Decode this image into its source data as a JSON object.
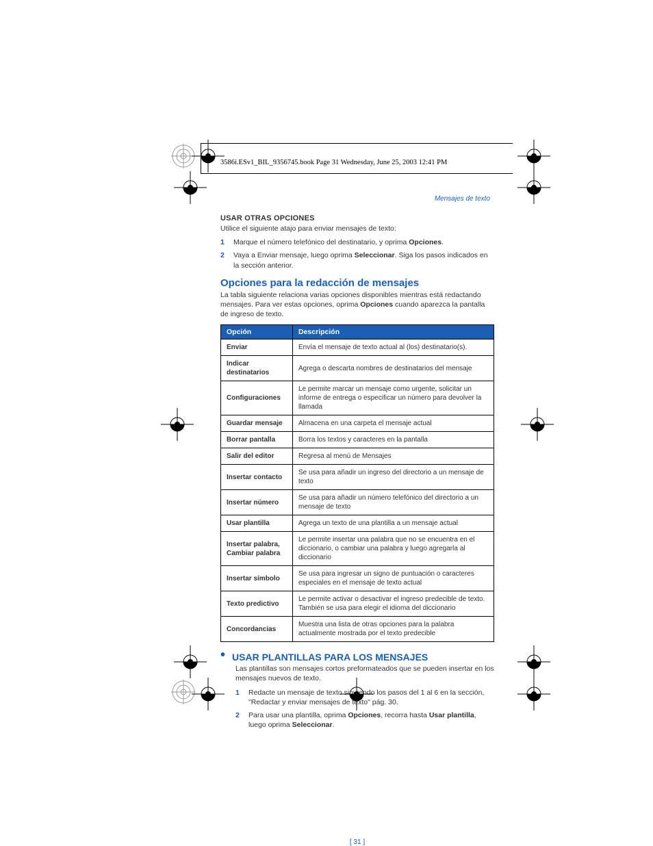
{
  "header": "3586i.ESv1_BIL_9356745.book  Page 31  Wednesday, June 25, 2003  12:41 PM",
  "breadcrumb": "Mensajes de texto",
  "s1_title": "USAR OTRAS OPCIONES",
  "s1_intro": "Utilice el siguiente atajo para enviar mensajes de texto:",
  "s1_li1_a": "Marque el número telefónico del destinatario, y oprima ",
  "s1_li1_b": "Opciones",
  "s1_li1_c": ".",
  "s1_li2_a": "Vaya a Enviar mensaje, luego oprima ",
  "s1_li2_b": "Seleccionar",
  "s1_li2_c": ". Siga los pasos indicados en la sección anterior.",
  "h2_a": "Opciones para la redacción de mensajes",
  "h2_a_p1": "La tabla siguiente relaciona varias opciones disponibles mientras está redactando mensajes. Para ver estas opciones, oprima ",
  "h2_a_p1_b": "Opciones",
  "h2_a_p1_c": " cuando aparezca la pantalla de ingreso de texto.",
  "th1": "Opción",
  "th2": "Descripción",
  "rows": [
    {
      "o": "Enviar",
      "d": "Envía el mensaje de texto actual al (los) destinatario(s)."
    },
    {
      "o": "Indicar destinatarios",
      "d": "Agrega o descarta nombres de destinatarios del mensaje"
    },
    {
      "o": "Configuraciones",
      "d": "Le permite marcar un mensaje como urgente, solicitar un informe de entrega o especificar un número para devolver la llamada"
    },
    {
      "o": "Guardar mensaje",
      "d": "Almacena en una carpeta el mensaje actual"
    },
    {
      "o": "Borrar pantalla",
      "d": "Borra los textos y caracteres en la pantalla"
    },
    {
      "o": "Salir del editor",
      "d": "Regresa al menú de Mensajes"
    },
    {
      "o": "Insertar contacto",
      "d": "Se usa para añadir un ingreso del directorio a un mensaje de texto"
    },
    {
      "o": "Insertar número",
      "d": "Se usa para añadir un número telefónico del directorio a un mensaje de texto"
    },
    {
      "o": "Usar plantilla",
      "d": "Agrega un texto de una plantilla a un mensaje actual"
    },
    {
      "o": "Insertar palabra, Cambiar palabra",
      "d": "Le permite insertar una palabra que no se encuentra en el diccionario, o cambiar una palabra y luego agregarla al diccionario"
    },
    {
      "o": "Insertar símbolo",
      "d": "Se usa para ingresar un signo de puntuación o caracteres especiales en el mensaje de texto actual"
    },
    {
      "o": "Texto predictivo",
      "d": "Le permite activar o desactivar el ingreso predecible de texto. También se usa para elegir el idioma del diccionario"
    },
    {
      "o": "Concordancias",
      "d": "Muestra una lista de otras opciones para la palabra actualmente mostrada por el texto predecible"
    }
  ],
  "h2_b": "USAR PLANTILLAS PARA LOS MENSAJES",
  "h2_b_p": "Las plantillas son mensajes cortos preformateados que se pueden insertar en los mensajes nuevos de texto.",
  "s3_li1": "Redacte un mensaje de texto siguiendo los pasos del 1 al 6 en la sección, \"Redactar y enviar mensajes de texto\" pág. 30.",
  "s3_li2_a": "Para usar una plantilla, oprima ",
  "s3_li2_b": "Opciones",
  "s3_li2_c": ", recorra hasta ",
  "s3_li2_d": "Usar plantilla",
  "s3_li2_e": ", luego oprima ",
  "s3_li2_f": "Seleccionar",
  "s3_li2_g": ".",
  "page_num": "[ 31 ]"
}
